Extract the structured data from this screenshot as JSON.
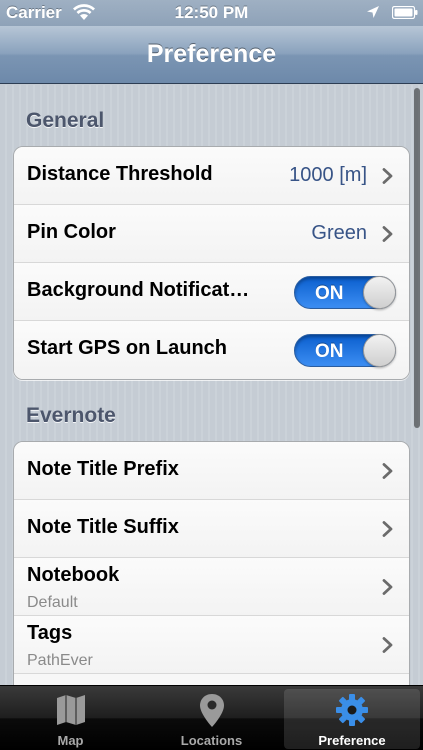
{
  "status_bar": {
    "carrier": "Carrier",
    "time": "12:50 PM"
  },
  "nav": {
    "title": "Preference"
  },
  "sections": {
    "general": {
      "header": "General",
      "rows": [
        {
          "label": "Distance Threshold",
          "value": "1000 [m]"
        },
        {
          "label": "Pin Color",
          "value": "Green"
        },
        {
          "label": "Background Notificat…",
          "toggle": "ON"
        },
        {
          "label": "Start GPS on Launch",
          "toggle": "ON"
        }
      ]
    },
    "evernote": {
      "header": "Evernote",
      "rows": [
        {
          "label": "Note Title Prefix"
        },
        {
          "label": "Note Title Suffix"
        },
        {
          "label": "Notebook",
          "sublabel": "Default"
        },
        {
          "label": "Tags",
          "sublabel": "PathEver"
        }
      ]
    }
  },
  "tabs": [
    {
      "label": "Map",
      "icon": "map-icon"
    },
    {
      "label": "Locations",
      "icon": "pin-icon"
    },
    {
      "label": "Preference",
      "icon": "gear-icon",
      "active": true
    }
  ],
  "colors": {
    "accent": "#385487",
    "toggle_on": "#1f74e6",
    "gear_blue": "#3a8ee8"
  }
}
